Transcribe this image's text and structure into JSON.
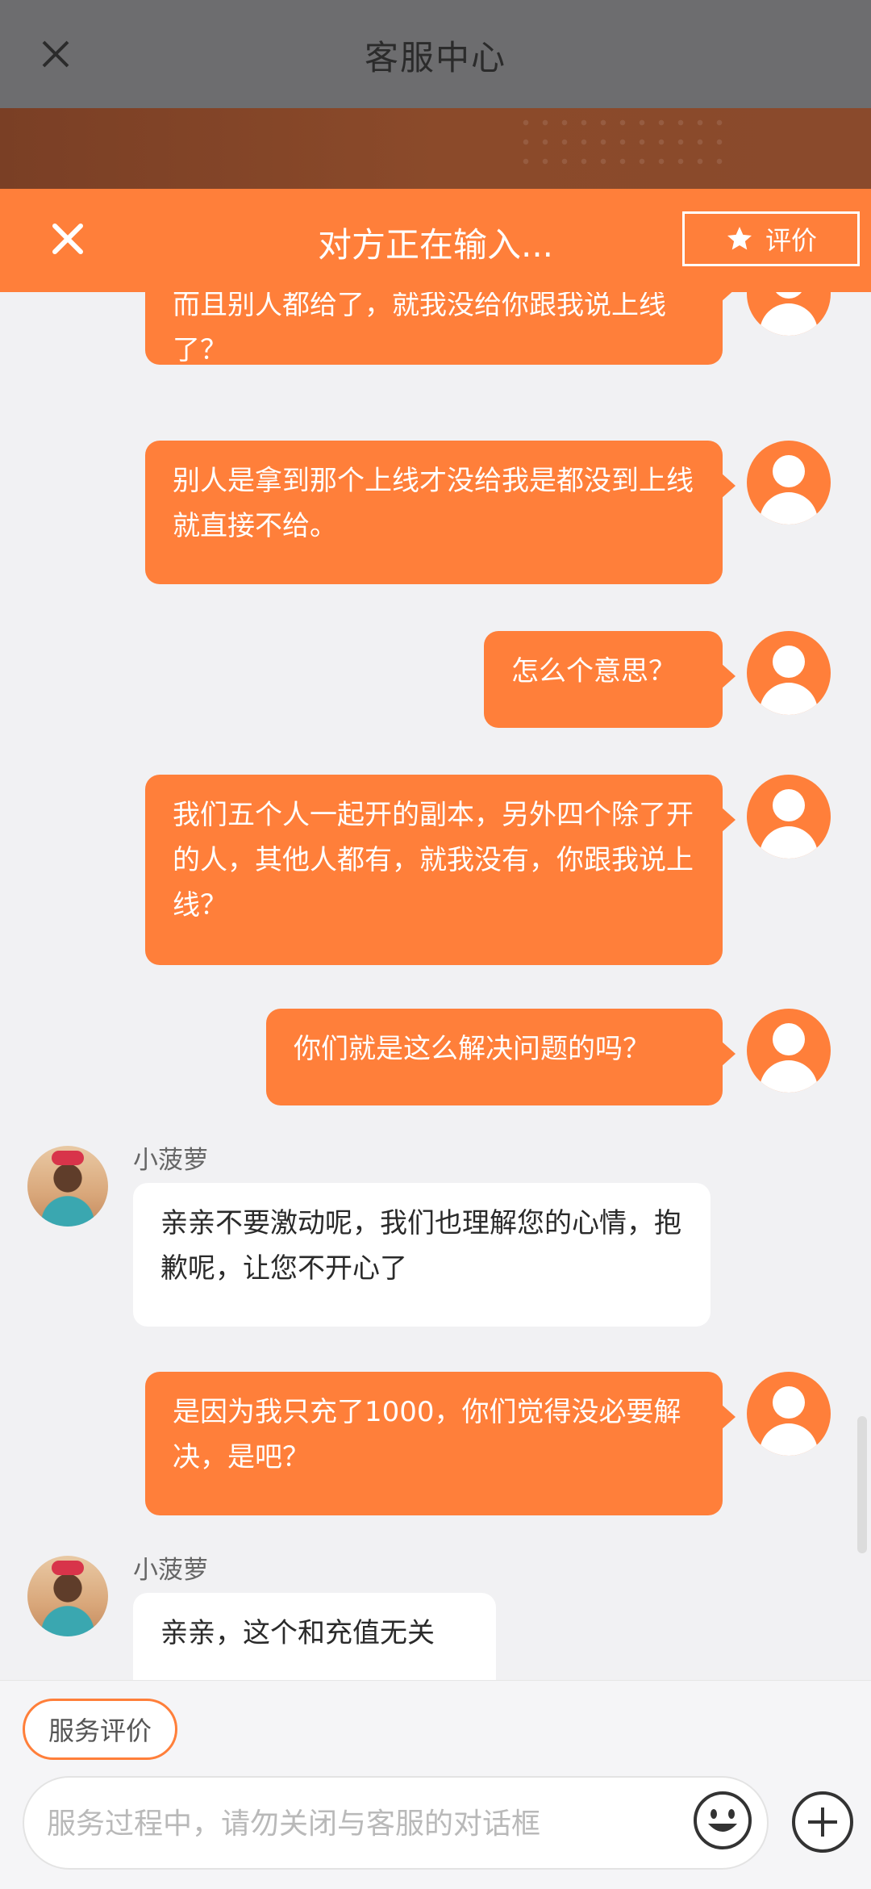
{
  "app_bar": {
    "title": "客服中心"
  },
  "chat_header": {
    "status_text": "对方正在输入...",
    "rate_label": "评价"
  },
  "messages": [
    {
      "side": "out",
      "text": "而且别人都给了，就我没给你跟我说上线了？"
    },
    {
      "side": "out",
      "text": "别人是拿到那个上线才没给我是都没到上线就直接不给。"
    },
    {
      "side": "out",
      "text": "怎么个意思？"
    },
    {
      "side": "out",
      "text": "我们五个人一起开的副本，另外四个除了开的人，其他人都有，就我没有，你跟我说上线？"
    },
    {
      "side": "out",
      "text": "你们就是这么解决问题的吗？"
    },
    {
      "side": "in",
      "name": "小菠萝",
      "text": "亲亲不要激动呢，我们也理解您的心情，抱歉呢，让您不开心了"
    },
    {
      "side": "out",
      "text": "是因为我只充了1000，你们觉得没必要解决，是吧？"
    },
    {
      "side": "in",
      "name": "小菠萝",
      "text": "亲亲，这个和充值无关"
    }
  ],
  "bottom": {
    "service_rate_label": "服务评价",
    "input_placeholder": "服务过程中，请勿关闭与客服的对话框"
  },
  "colors": {
    "accent": "#ff7f3a",
    "background": "#f1f1f3"
  },
  "icons": [
    "close-icon",
    "star-icon",
    "user-avatar-icon",
    "emoji-icon",
    "plus-icon"
  ]
}
